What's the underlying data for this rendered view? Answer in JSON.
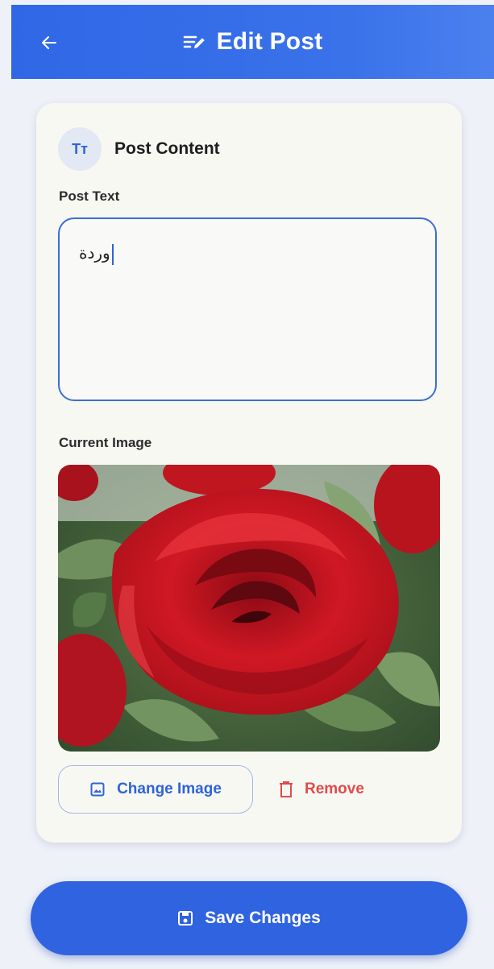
{
  "header": {
    "title": "Edit Post",
    "back_icon": "arrow-left-icon",
    "title_icon": "edit-note-icon",
    "background": "#3a72ea"
  },
  "card": {
    "section_title": "Post Content",
    "section_icon": "text-fields-icon",
    "section_icon_text": "Tт",
    "post_text_label": "Post Text",
    "post_text_value": "وردة",
    "current_image_label": "Current Image",
    "image_description": "red-rose-photo",
    "change_image_label": "Change Image",
    "change_image_icon": "image-icon",
    "remove_label": "Remove",
    "remove_icon": "trash-icon"
  },
  "footer": {
    "save_label": "Save Changes",
    "save_icon": "save-icon",
    "accent": "#2f63e0"
  },
  "colors": {
    "primary": "#2f63d8",
    "danger": "#e04b4b",
    "card_bg": "#f8f8f3",
    "page_bg": "#eef1f8"
  }
}
